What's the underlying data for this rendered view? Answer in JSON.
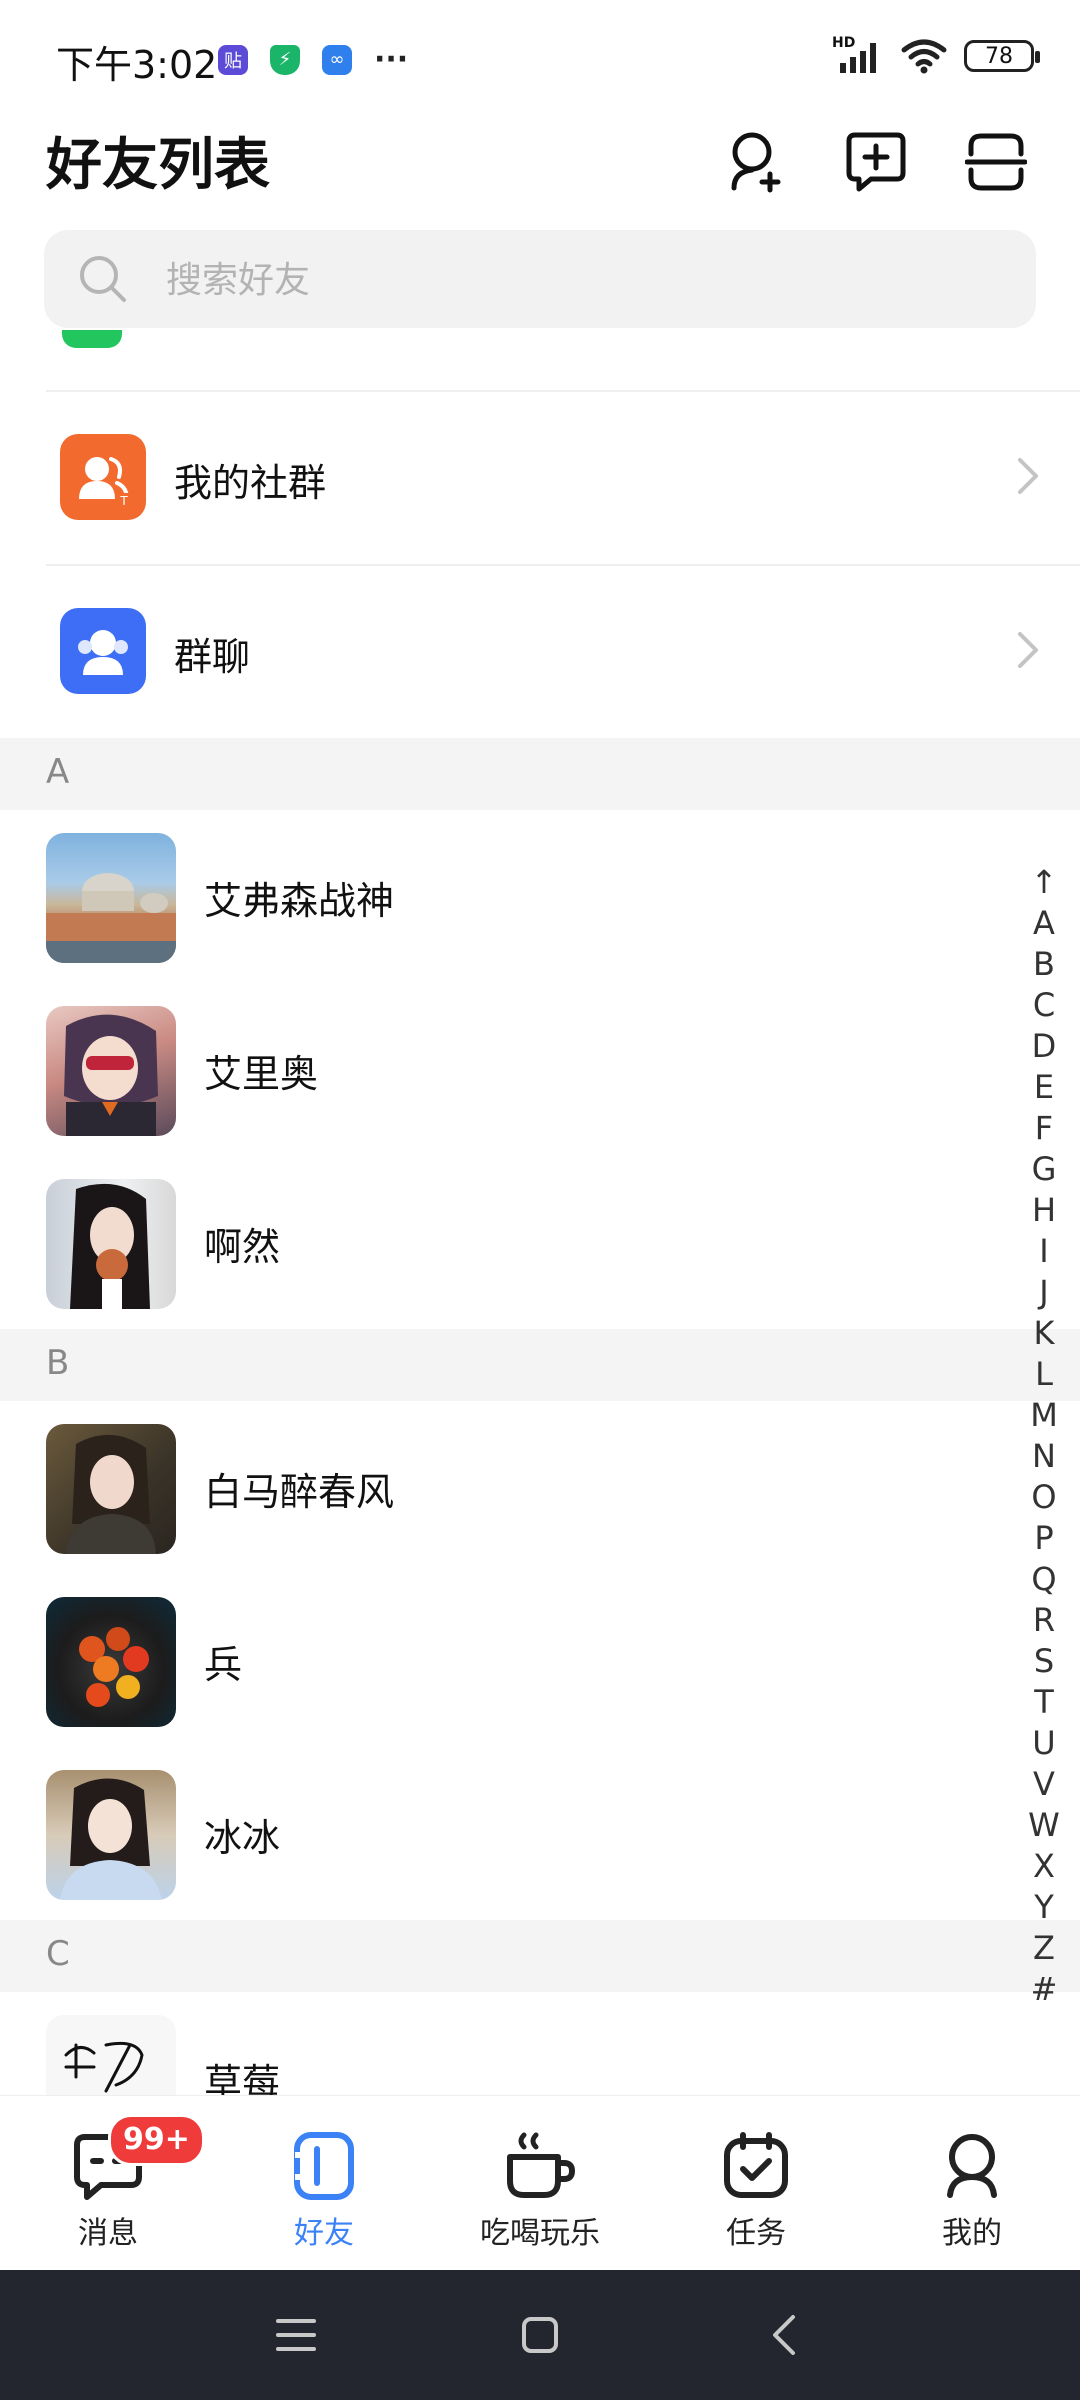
{
  "status_bar": {
    "time": "下午3:02",
    "battery": "78",
    "network": "HD",
    "more": "···"
  },
  "header": {
    "title": "好友列表"
  },
  "search": {
    "placeholder": "搜索好友"
  },
  "entries": [
    {
      "label": "我的社群",
      "color": "#f26a2e",
      "icon": "community-icon"
    },
    {
      "label": "群聊",
      "color": "#3d6ef5",
      "icon": "group-chat-icon"
    }
  ],
  "sections": [
    {
      "letter": "A",
      "friends": [
        "艾弗森战神",
        "艾里奥",
        "啊然"
      ]
    },
    {
      "letter": "B",
      "friends": [
        "白马醉春风",
        "兵",
        "冰冰"
      ]
    },
    {
      "letter": "C",
      "friends": [
        "草莓"
      ]
    }
  ],
  "index": [
    "↑",
    "A",
    "B",
    "C",
    "D",
    "E",
    "F",
    "G",
    "H",
    "I",
    "J",
    "K",
    "L",
    "M",
    "N",
    "O",
    "P",
    "Q",
    "R",
    "S",
    "T",
    "U",
    "V",
    "W",
    "X",
    "Y",
    "Z",
    "#"
  ],
  "tabs": [
    {
      "label": "消息",
      "badge": "99+",
      "icon": "message-icon",
      "active": false
    },
    {
      "label": "好友",
      "icon": "friends-icon",
      "active": true
    },
    {
      "label": "吃喝玩乐",
      "icon": "coffee-icon",
      "active": false
    },
    {
      "label": "任务",
      "icon": "task-calendar-icon",
      "active": false
    },
    {
      "label": "我的",
      "icon": "profile-icon",
      "active": false
    }
  ],
  "colors": {
    "accent": "#3b82f6",
    "badge": "#f03b3b",
    "community": "#f26a2e",
    "group_chat": "#3d6ef5"
  }
}
